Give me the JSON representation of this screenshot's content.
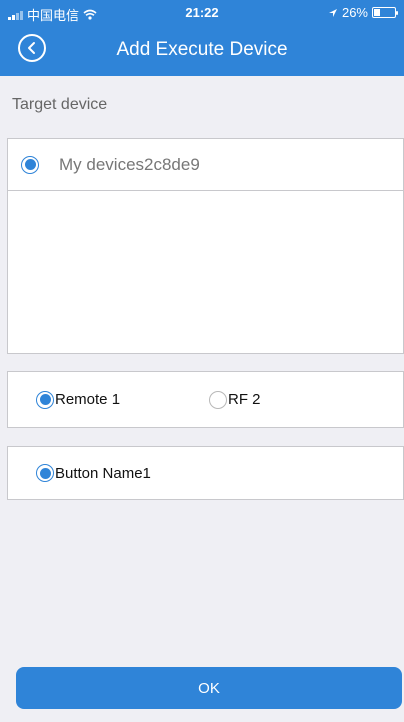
{
  "status_bar": {
    "carrier": "中国电信",
    "time": "21:22",
    "battery": "26%",
    "battery_level": 0.26,
    "icons": [
      "signal-icon",
      "wifi-icon",
      "location-arrow-icon",
      "battery-icon"
    ]
  },
  "header": {
    "title": "Add Execute Device",
    "back_icon": "back-arrow-icon",
    "color": "#2f84d8"
  },
  "target_section": {
    "label": "Target device",
    "devices": [
      {
        "name": "My devices2c8de9",
        "selected": true
      }
    ]
  },
  "remote_options": [
    {
      "label": "Remote 1",
      "selected": true
    },
    {
      "label": "RF 2",
      "selected": false
    }
  ],
  "button_options": [
    {
      "label": "Button Name1",
      "selected": true
    }
  ],
  "footer": {
    "ok_label": "OK"
  }
}
